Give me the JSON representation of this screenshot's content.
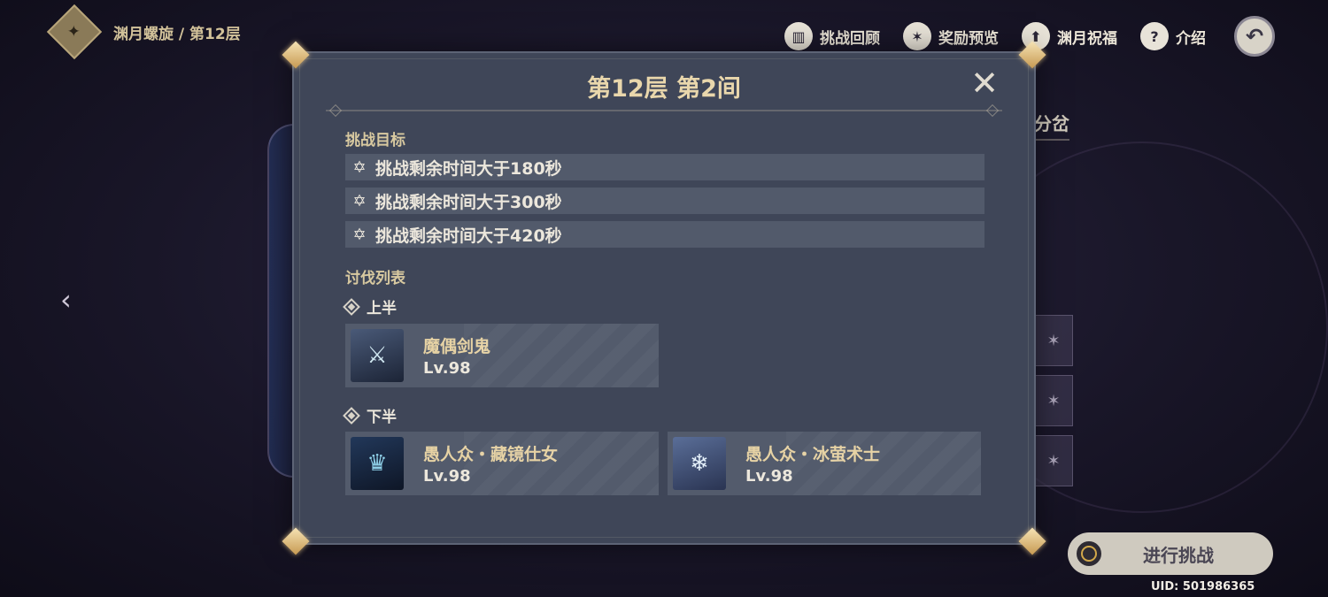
{
  "header": {
    "breadcrumb": "渊月螺旋 / 第12层",
    "buttons": [
      {
        "label": "挑战回顾",
        "icon": "book-icon"
      },
      {
        "label": "奖励预览",
        "icon": "star-icon"
      },
      {
        "label": "渊月祝福",
        "icon": "upload-icon"
      },
      {
        "label": "介绍",
        "icon": "help-icon"
      }
    ]
  },
  "background": {
    "side_text": "分岔"
  },
  "dialog": {
    "title": "第12层 第2间",
    "objectives_label": "挑战目标",
    "objectives": [
      "挑战剩余时间大于180秒",
      "挑战剩余时间大于300秒",
      "挑战剩余时间大于420秒"
    ],
    "enemy_list_label": "讨伐列表",
    "first_half": {
      "label": "上半",
      "enemies": [
        {
          "name": "魔偶剑鬼",
          "level": "Lv.98"
        }
      ]
    },
    "second_half": {
      "label": "下半",
      "enemies": [
        {
          "name": "愚人众・藏镜仕女",
          "level": "Lv.98"
        },
        {
          "name": "愚人众・冰萤术士",
          "level": "Lv.98"
        }
      ]
    }
  },
  "footer": {
    "start_button": "进行挑战",
    "uid": "UID: 501986365"
  },
  "colors": {
    "accent_gold": "#e9d7ac",
    "dialog_bg": "#3f4658",
    "row_bg": "#525a6b"
  }
}
